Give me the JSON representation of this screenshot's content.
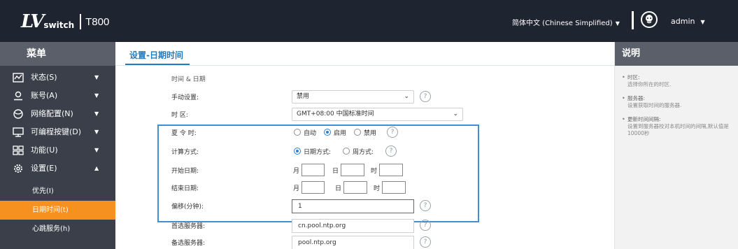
{
  "header": {
    "logo_mark": "LV",
    "logo_sub": "switch",
    "model": "T800",
    "language": "简体中文 (Chinese Simplified)",
    "user": "admin"
  },
  "sidebar": {
    "title": "菜单",
    "items": [
      {
        "label": "状态(S)",
        "icon": "status-chart-icon"
      },
      {
        "label": "账号(A)",
        "icon": "account-user-icon"
      },
      {
        "label": "网络配置(N)",
        "icon": "network-icon"
      },
      {
        "label": "可编程按键(D)",
        "icon": "keyboard-icon"
      },
      {
        "label": "功能(U)",
        "icon": "grid-icon"
      },
      {
        "label": "设置(E)",
        "icon": "gear-icon"
      }
    ],
    "subitems": [
      {
        "label": "优先(I)"
      },
      {
        "label": "日期时间(t)"
      },
      {
        "label": "心跳服务(h)"
      }
    ]
  },
  "content": {
    "tab_title": "设置-日期时间",
    "section_label": "时间 & 日期",
    "manual_setting": {
      "label": "手动设置:",
      "value": "禁用"
    },
    "timezone": {
      "label": "时 区:",
      "value": "GMT+08:00 中国标准时间"
    },
    "dst": {
      "label": "夏 令 时:",
      "options": [
        "自动",
        "启用",
        "禁用"
      ],
      "selected": "启用"
    },
    "calc": {
      "label": "计算方式:",
      "options": [
        "日期方式:",
        "周方式:"
      ],
      "selected": "日期方式:"
    },
    "start_date": {
      "label": "开始日期:",
      "month": "月",
      "day": "日",
      "hour": "时"
    },
    "end_date": {
      "label": "结束日期:",
      "month": "月",
      "day": "日",
      "hour": "时"
    },
    "offset": {
      "label": "偏移(分钟):",
      "value": "1"
    },
    "primary_server": {
      "label": "首选服务器:",
      "value": "cn.pool.ntp.org"
    },
    "secondary_server": {
      "label": "备选服务器:",
      "value": "pool.ntp.org"
    }
  },
  "help": {
    "title": "说明",
    "items": [
      {
        "title": "时区:",
        "desc": "选择你所在的时区."
      },
      {
        "title": "服务器:",
        "desc": "设置获取时间的服务器."
      },
      {
        "title": "更新时间间隔:",
        "desc": "设置到服务器校对本机时间的间隔,默认值是10000秒"
      }
    ]
  },
  "colors": {
    "topbar": "#1f2530",
    "sidebar": "#3a3f4a",
    "active": "#f6901e",
    "accent": "#1f7cc2"
  }
}
